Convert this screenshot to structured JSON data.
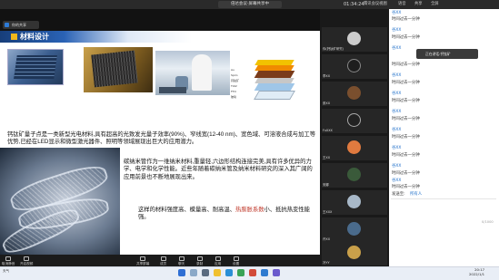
{
  "window": {
    "title": "Ki?",
    "meeting_title": "倍达会议-屏幕共享中",
    "timer": "01:34:24",
    "topbar_buttons": [
      "腾讯会议视图",
      "语音",
      "共享",
      "全屏"
    ]
  },
  "share_bar": {
    "label": "你的共享"
  },
  "slide": {
    "title": "材料设计",
    "structure_labels": [
      "Au",
      "Spiro",
      "钙钛矿",
      "TiO2",
      "FTO",
      "玻璃"
    ],
    "paragraph1": "钙钛矿量子点是一类新型光电材料,具有超高的光致发光量子效率(90%)、窄线宽(12-40 nm)、宽色域、可溶液合成与加工等优势,已经在LED显示和微型激光器件、照明等领域展现出巨大的应用潜力。",
    "paragraph2": "碳纳米管作为一维纳米材料,重量轻,六边形结构连接完美,具有许多优异的力学、电学和化学性能。近些年随着碳纳米管及纳米材料研究的深入其广阔的应用前景也不断地展现出来。",
    "paragraph3_pre": "这样的材料强度高、模量高、耐高温、",
    "paragraph3_link": "热膨胀系数",
    "paragraph3_post": "小、抵抗热变性能强。"
  },
  "toolbar": {
    "items": [
      "取消静音",
      "开启视频",
      "共享屏幕",
      "成员",
      "聊天",
      "录制",
      "应用",
      "设置"
    ],
    "leave": "离开会议"
  },
  "participants": [
    {
      "name": "你(钙钛矿研究)"
    },
    {
      "name": "李XX"
    },
    {
      "name": "张XX"
    },
    {
      "name": "FuXXX"
    },
    {
      "name": "王XX"
    },
    {
      "name": "安娜"
    },
    {
      "name": "王XXX"
    },
    {
      "name": "许XX"
    },
    {
      "name": "冷YY"
    }
  ],
  "chat": {
    "messages": [
      {
        "name": "谷XX",
        "text": "时间过去一分钟"
      },
      {
        "name": "谷XX",
        "text": "时间过去一分钟"
      },
      {
        "name": "谷XX",
        "text": "时间过去一分钟"
      },
      {
        "name": "谷XX",
        "text": "时间过去一分钟"
      },
      {
        "name": "谷XX",
        "text": "时间过去一分钟"
      },
      {
        "name": "谷XX",
        "text": "时间过去一分钟"
      },
      {
        "name": "谷XX",
        "text": "时间过去一分钟"
      },
      {
        "name": "谷XX",
        "text": "时间过去一分钟"
      },
      {
        "name": "谷XX",
        "text": "时间过去一分钟"
      },
      {
        "name": "谷XX",
        "text": "时间过去一分钟"
      },
      {
        "name": "谷XX",
        "text": "时间过去一分钟"
      }
    ],
    "tip": "正在讲话:钙钛矿",
    "send_to_label": "发送至:",
    "send_to_value": "所有人",
    "char_count": "0/1000"
  },
  "taskbar": {
    "time": "20:17",
    "date": "2022/1/1",
    "left_label": "天气"
  },
  "colors": {
    "accent": "#1d6ec9",
    "title_bar": "#173e7a",
    "leave": "#d9534f"
  }
}
